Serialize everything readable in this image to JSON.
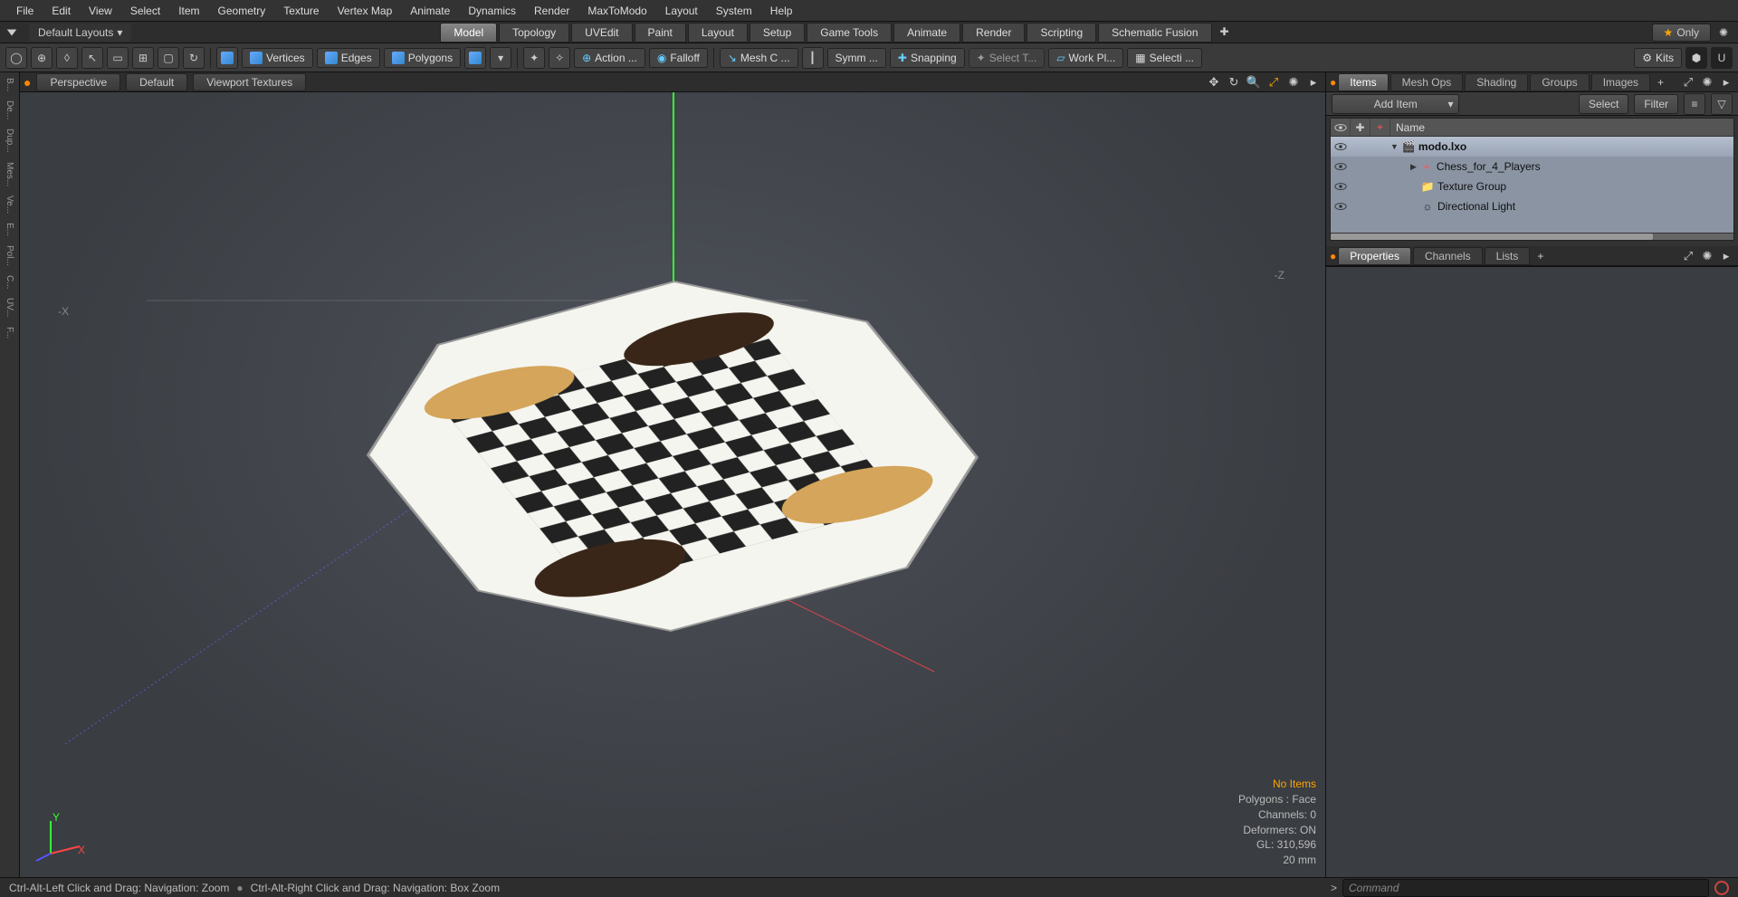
{
  "menu": [
    "File",
    "Edit",
    "View",
    "Select",
    "Item",
    "Geometry",
    "Texture",
    "Vertex Map",
    "Animate",
    "Dynamics",
    "Render",
    "MaxToModo",
    "Layout",
    "System",
    "Help"
  ],
  "layout_dropdown": "Default Layouts",
  "tabs": [
    "Model",
    "Topology",
    "UVEdit",
    "Paint",
    "Layout",
    "Setup",
    "Game Tools",
    "Animate",
    "Render",
    "Scripting",
    "Schematic Fusion"
  ],
  "active_tab": "Model",
  "only_label": "Only",
  "toolbar": {
    "vertices": "Vertices",
    "edges": "Edges",
    "polygons": "Polygons",
    "action": "Action   ...",
    "falloff": "Falloff",
    "meshc": "Mesh C ...",
    "symm": "Symm ...",
    "snapping": "Snapping",
    "selectt": "Select T...",
    "workpl": "Work Pl...",
    "selecti": "Selecti ...",
    "kits": "Kits"
  },
  "left_rail": [
    "B...",
    "De...",
    "Dup...",
    "Mes...",
    "Ve...",
    "E...",
    "Pol...",
    "C...",
    "UV...",
    "F..."
  ],
  "viewport": {
    "perspective": "Perspective",
    "default": "Default",
    "textures": "Viewport Textures"
  },
  "x_label": "-X",
  "z_label": "-Z",
  "y_axis_label": "Y",
  "x_axis_label": "X",
  "stats": {
    "noitems": "No Items",
    "polys": "Polygons : Face",
    "channels": "Channels: 0",
    "deformers": "Deformers: ON",
    "gl": "GL: 310,596",
    "units": "20 mm"
  },
  "items_panel": {
    "tabs": [
      "Items",
      "Mesh Ops",
      "Shading",
      "Groups",
      "Images"
    ],
    "active": "Items",
    "add_item": "Add Item",
    "select": "Select",
    "filter": "Filter",
    "name_header": "Name",
    "tree": [
      {
        "label": "modo.lxo",
        "indent": 0,
        "bold": true,
        "icon": "scene"
      },
      {
        "label": "Chess_for_4_Players",
        "indent": 1,
        "icon": "axes"
      },
      {
        "label": "Texture Group",
        "indent": 1,
        "icon": "folder"
      },
      {
        "label": "Directional Light",
        "indent": 1,
        "icon": "light"
      }
    ]
  },
  "prop_panel": {
    "tabs": [
      "Properties",
      "Channels",
      "Lists"
    ],
    "active": "Properties"
  },
  "statusbar": {
    "hint1": "Ctrl-Alt-Left Click and Drag: Navigation: Zoom",
    "hint2": "Ctrl-Alt-Right Click and Drag: Navigation: Box Zoom",
    "cmd_placeholder": "Command",
    "prompt": ">"
  }
}
